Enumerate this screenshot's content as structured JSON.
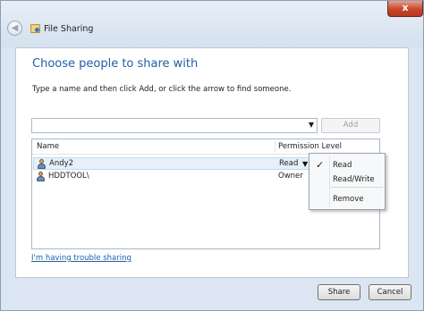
{
  "window": {
    "title": "File Sharing",
    "close_glyph": "x"
  },
  "main": {
    "heading": "Choose people to share with",
    "instruction": "Type a name and then click Add, or click the arrow to find someone.",
    "add_button": "Add",
    "columns": [
      "Name",
      "Permission Level"
    ],
    "users": [
      {
        "name": "Andy2",
        "permission": "Read",
        "selected": true
      },
      {
        "name": "HDDTOOL\\",
        "permission": "Owner",
        "selected": false
      }
    ],
    "trouble_link": "I'm having trouble sharing"
  },
  "permission_menu": {
    "items": [
      {
        "label": "Read",
        "checked": true
      },
      {
        "label": "Read/Write",
        "checked": false
      },
      {
        "label": "Remove",
        "checked": false
      }
    ],
    "check_glyph": "✓"
  },
  "footer": {
    "share_button": "Share",
    "cancel_button": "Cancel"
  },
  "colors": {
    "heading": "#1f5fa8",
    "link": "#1f5fa8",
    "close_button": "#c8462b",
    "frame": "#dbe6f2"
  }
}
